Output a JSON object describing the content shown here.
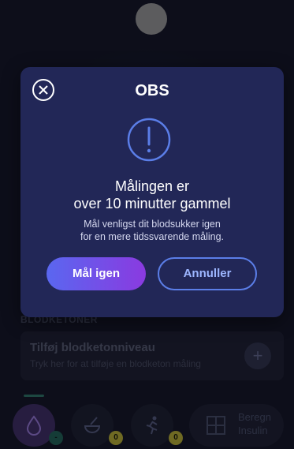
{
  "background": {
    "ketones_section_label": "BLODKETONER",
    "ketone_card": {
      "title": "Tilføj blodketonniveau",
      "subtitle": "Tryk her for at tilføje en blodketon måling",
      "add_symbol": "+"
    },
    "bottom_nav": {
      "drop_badge": "-",
      "food_badge": "0",
      "activity_badge": "0",
      "calc_label": "Beregn Insulin"
    }
  },
  "dialog": {
    "title": "OBS",
    "heading_line1": "Målingen er",
    "heading_line2": "over 10 minutter gammel",
    "body_line1": "Mål venligst dit blodsukker igen",
    "body_line2": "for en mere tidssvarende måling.",
    "primary_button": "Mål igen",
    "secondary_button": "Annuller"
  },
  "colors": {
    "dialog_bg": "#222757",
    "primary_gradient_start": "#5a67f0",
    "primary_gradient_end": "#8a3ae0",
    "secondary_border": "#5b7ee8",
    "warning_icon": "#5b7ee8"
  },
  "icons": [
    "close-icon",
    "warning-icon",
    "blood-drop-icon",
    "food-bowl-icon",
    "activity-runner-icon",
    "calculator-icon",
    "plus-icon"
  ]
}
